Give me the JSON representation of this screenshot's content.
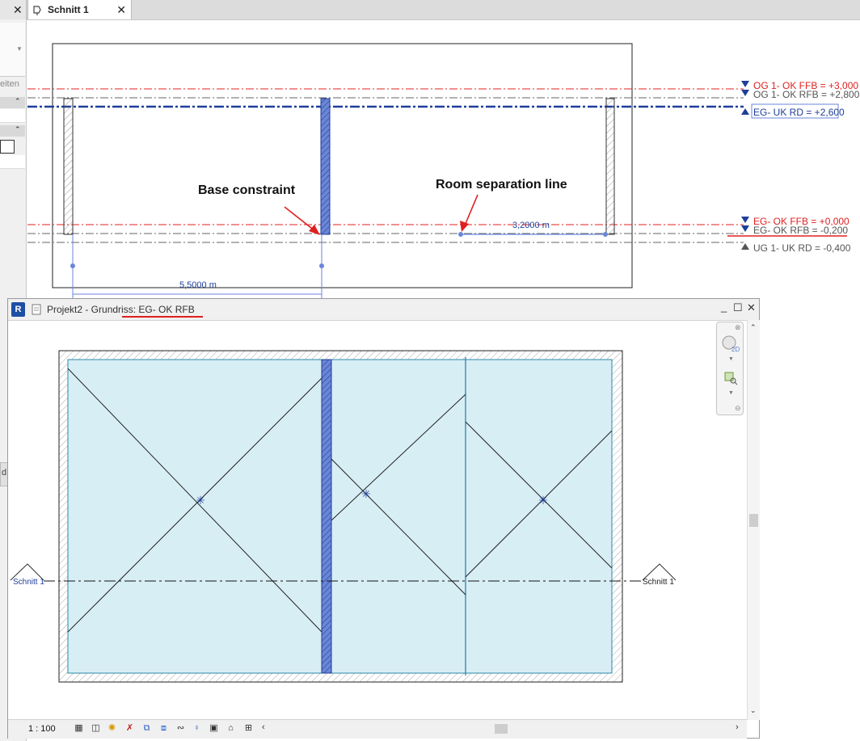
{
  "tabs": [
    {
      "label": "Schnitt 1"
    }
  ],
  "left_panel": {
    "partial_label_1": "eiten",
    "partial_label_2": "d"
  },
  "section_view": {
    "levels": [
      {
        "label": "OG 1- OK FFB = +3,000",
        "color": "#e02020"
      },
      {
        "label": "OG 1- OK RFB = +2,800",
        "color": "#555555"
      },
      {
        "label": "EG- UK RD = +2,600",
        "color": "#1e3f9a"
      },
      {
        "label": "EG- OK FFB = +0,000",
        "color": "#e02020"
      },
      {
        "label": "EG- OK RFB = -0,200",
        "color": "#555555"
      },
      {
        "label": "UG 1- UK RD = -0,400",
        "color": "#555555"
      }
    ],
    "dimensions": {
      "wall_offset": "5,5000 m",
      "line_length": "3,2000 m"
    },
    "annotations": {
      "base_constraint": "Base constraint",
      "room_separation": "Room separation line"
    }
  },
  "plan_window": {
    "title_prefix": "Projekt2 - Grundriss: ",
    "title_level": "EG- OK RFB",
    "section_tag_left": "Schnitt 1",
    "section_tag_right": "Schnitt 1",
    "scale": "1 : 100",
    "window_controls": {
      "minimize": "_",
      "maximize": "☐",
      "close": "✕"
    }
  },
  "colors": {
    "room_fill": "#d8eef5",
    "wall_highlight": "#6a86d8",
    "annotation_red": "#e02020",
    "level_blue": "#1e3f9a"
  },
  "icons": [
    "revit-logo-icon",
    "view-cube-2d-icon",
    "zoom-region-icon",
    "detail-level-icon",
    "visual-style-icon",
    "sun-path-icon",
    "shadows-icon",
    "crop-view-icon",
    "hide-icon",
    "temp-hide-icon",
    "analytical-icon",
    "highlight-displacement-icon",
    "reveal-constraints-icon"
  ]
}
